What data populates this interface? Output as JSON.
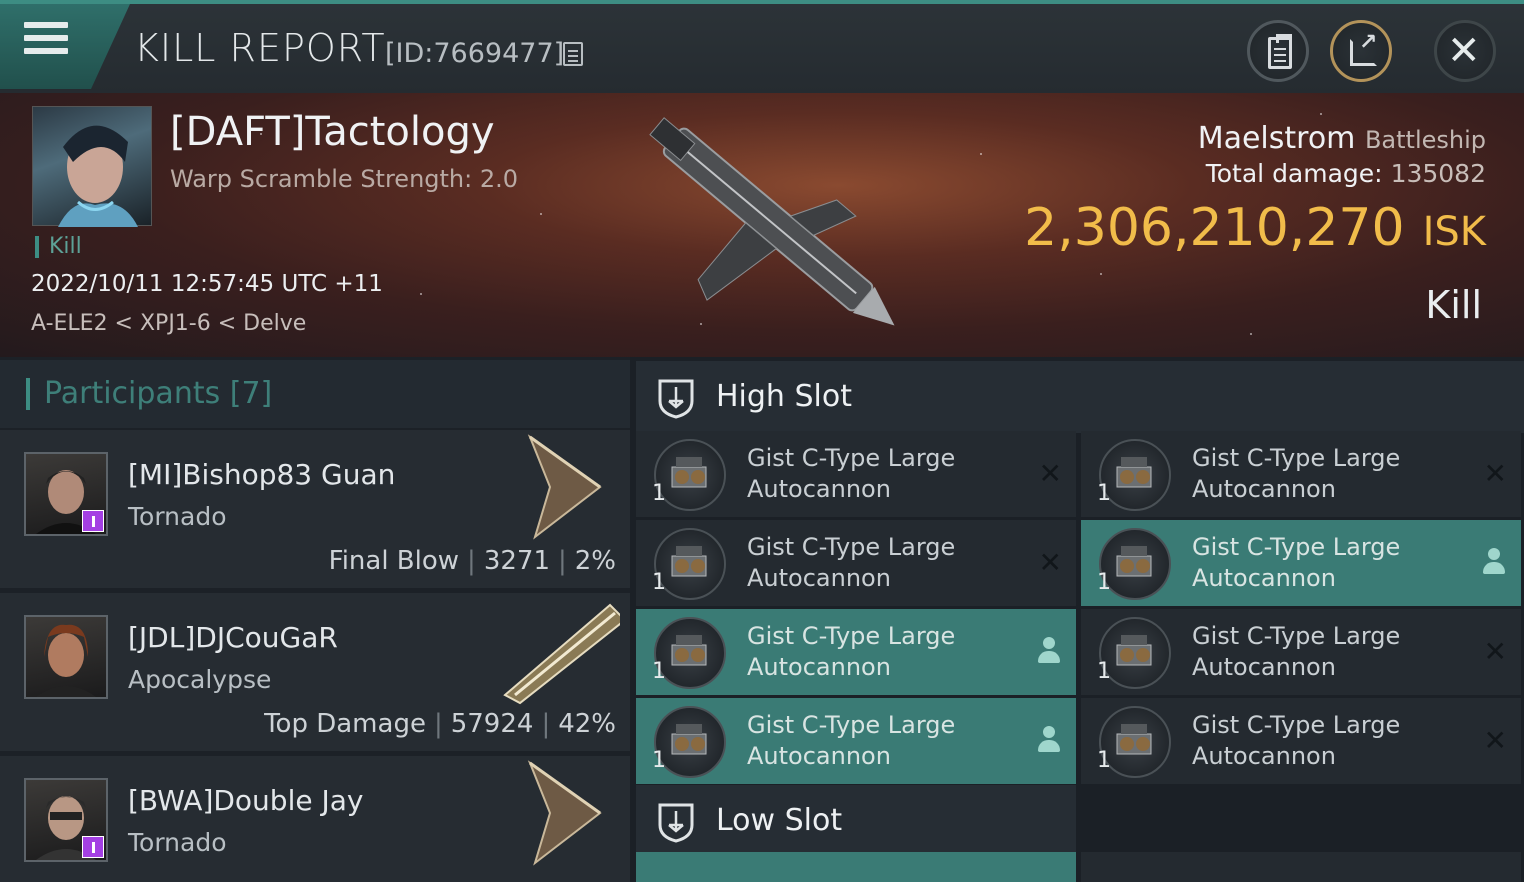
{
  "header": {
    "title": "KILL REPORT",
    "report_id": "[ID:7669477]",
    "icons": [
      "menu-icon",
      "copy-icon",
      "clipboard-icon",
      "share-icon",
      "close-icon"
    ]
  },
  "victim": {
    "name": "[DAFT]Tactology",
    "warp_scramble": "Warp Scramble Strength: 2.0",
    "tag": "Kill",
    "datetime": "2022/10/11 12:57:45 UTC +11",
    "location": "A-ELE2 < XPJ1-6 < Delve",
    "ship_name": "Maelstrom",
    "ship_class": "Battleship",
    "damage_label": "Total damage:",
    "damage_value": "135082",
    "isk_value": "2,306,210,270",
    "isk_unit": "ISK",
    "result": "Kill"
  },
  "participants": {
    "title": "Participants [7]",
    "items": [
      {
        "name": "[MI]Bishop83 Guan",
        "ship": "Tornado",
        "role": "Final Blow",
        "damage": "3271",
        "percent": "2%",
        "badge": true
      },
      {
        "name": "[JDL]DJCouGaR",
        "ship": "Apocalypse",
        "role": "Top Damage",
        "damage": "57924",
        "percent": "42%",
        "badge": false
      },
      {
        "name": "[BWA]Double Jay",
        "ship": "Tornado",
        "role": "",
        "damage": "",
        "percent": "",
        "badge": true
      }
    ]
  },
  "slots": {
    "high": {
      "title": "High Slot",
      "items": [
        {
          "line1": "Gist C-Type Large",
          "line2": "Autocannon",
          "qty": "1",
          "state": "destroyed"
        },
        {
          "line1": "Gist C-Type Large",
          "line2": "Autocannon",
          "qty": "1",
          "state": "destroyed"
        },
        {
          "line1": "Gist C-Type Large",
          "line2": "Autocannon",
          "qty": "1",
          "state": "destroyed"
        },
        {
          "line1": "Gist C-Type Large",
          "line2": "Autocannon",
          "qty": "1",
          "state": "dropped"
        },
        {
          "line1": "Gist C-Type Large",
          "line2": "Autocannon",
          "qty": "1",
          "state": "dropped"
        },
        {
          "line1": "Gist C-Type Large",
          "line2": "Autocannon",
          "qty": "1",
          "state": "destroyed"
        },
        {
          "line1": "Gist C-Type Large",
          "line2": "Autocannon",
          "qty": "1",
          "state": "dropped"
        },
        {
          "line1": "Gist C-Type Large",
          "line2": "Autocannon",
          "qty": "1",
          "state": "destroyed"
        }
      ]
    },
    "low": {
      "title": "Low Slot"
    }
  },
  "colors": {
    "accent": "#3d8d83",
    "isk": "#f1bc4a",
    "badge": "#a43fe3",
    "active_item": "#3a7b75"
  }
}
